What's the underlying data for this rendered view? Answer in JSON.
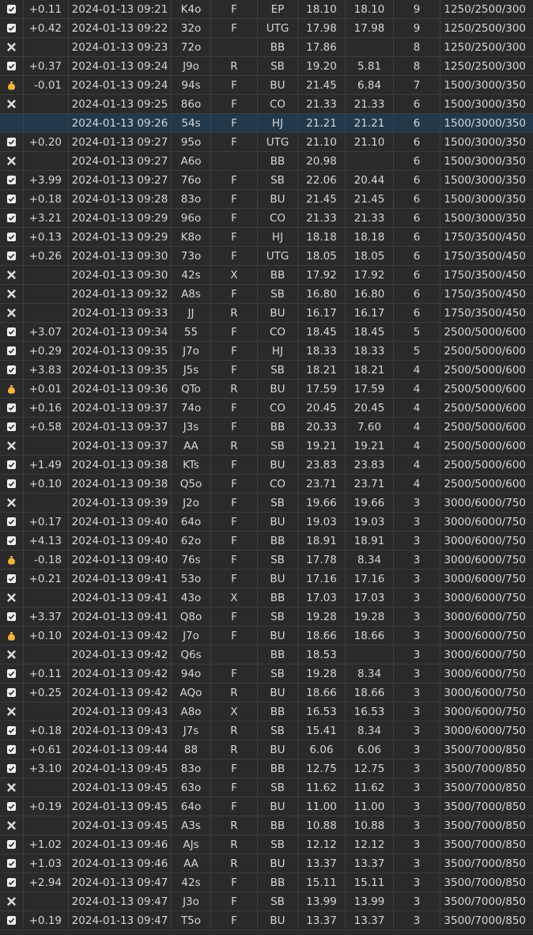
{
  "colors": {
    "background": "#2a2a2a",
    "selected_row": "#22394c",
    "check": "#f2f2f2",
    "x": "#dcdcdc",
    "bag": "#f0b53a"
  },
  "rows": [
    {
      "status": "check",
      "net": "+0.11",
      "time": "2024-01-13 09:21",
      "hand": "K4o",
      "action": "F",
      "pos": "EP",
      "stack": "18.10",
      "end": "18.10",
      "players": "9",
      "blinds": "1250/2500/300"
    },
    {
      "status": "check",
      "net": "+0.42",
      "time": "2024-01-13 09:22",
      "hand": "32o",
      "action": "F",
      "pos": "UTG",
      "stack": "17.98",
      "end": "17.98",
      "players": "9",
      "blinds": "1250/2500/300"
    },
    {
      "status": "x",
      "net": "",
      "time": "2024-01-13 09:23",
      "hand": "72o",
      "action": "",
      "pos": "BB",
      "stack": "17.86",
      "end": "",
      "players": "8",
      "blinds": "1250/2500/300"
    },
    {
      "status": "check",
      "net": "+0.37",
      "time": "2024-01-13 09:24",
      "hand": "J9o",
      "action": "R",
      "pos": "SB",
      "stack": "19.20",
      "end": "5.81",
      "players": "8",
      "blinds": "1250/2500/300"
    },
    {
      "status": "bag",
      "net": "-0.01",
      "time": "2024-01-13 09:24",
      "hand": "94s",
      "action": "F",
      "pos": "BU",
      "stack": "21.45",
      "end": "6.84",
      "players": "7",
      "blinds": "1500/3000/350"
    },
    {
      "status": "x",
      "net": "",
      "time": "2024-01-13 09:25",
      "hand": "86o",
      "action": "F",
      "pos": "CO",
      "stack": "21.33",
      "end": "21.33",
      "players": "6",
      "blinds": "1500/3000/350"
    },
    {
      "status": "",
      "net": "",
      "time": "2024-01-13 09:26",
      "hand": "54s",
      "action": "F",
      "pos": "HJ",
      "stack": "21.21",
      "end": "21.21",
      "players": "6",
      "blinds": "1500/3000/350",
      "selected": true
    },
    {
      "status": "check",
      "net": "+0.20",
      "time": "2024-01-13 09:27",
      "hand": "95o",
      "action": "F",
      "pos": "UTG",
      "stack": "21.10",
      "end": "21.10",
      "players": "6",
      "blinds": "1500/3000/350"
    },
    {
      "status": "x",
      "net": "",
      "time": "2024-01-13 09:27",
      "hand": "A6o",
      "action": "",
      "pos": "BB",
      "stack": "20.98",
      "end": "",
      "players": "6",
      "blinds": "1500/3000/350"
    },
    {
      "status": "check",
      "net": "+3.99",
      "time": "2024-01-13 09:27",
      "hand": "76o",
      "action": "F",
      "pos": "SB",
      "stack": "22.06",
      "end": "20.44",
      "players": "6",
      "blinds": "1500/3000/350"
    },
    {
      "status": "check",
      "net": "+0.18",
      "time": "2024-01-13 09:28",
      "hand": "83o",
      "action": "F",
      "pos": "BU",
      "stack": "21.45",
      "end": "21.45",
      "players": "6",
      "blinds": "1500/3000/350"
    },
    {
      "status": "check",
      "net": "+3.21",
      "time": "2024-01-13 09:29",
      "hand": "96o",
      "action": "F",
      "pos": "CO",
      "stack": "21.33",
      "end": "21.33",
      "players": "6",
      "blinds": "1500/3000/350"
    },
    {
      "status": "check",
      "net": "+0.13",
      "time": "2024-01-13 09:29",
      "hand": "K8o",
      "action": "F",
      "pos": "HJ",
      "stack": "18.18",
      "end": "18.18",
      "players": "6",
      "blinds": "1750/3500/450"
    },
    {
      "status": "check",
      "net": "+0.26",
      "time": "2024-01-13 09:30",
      "hand": "73o",
      "action": "F",
      "pos": "UTG",
      "stack": "18.05",
      "end": "18.05",
      "players": "6",
      "blinds": "1750/3500/450"
    },
    {
      "status": "x",
      "net": "",
      "time": "2024-01-13 09:30",
      "hand": "42s",
      "action": "X",
      "pos": "BB",
      "stack": "17.92",
      "end": "17.92",
      "players": "6",
      "blinds": "1750/3500/450"
    },
    {
      "status": "x",
      "net": "",
      "time": "2024-01-13 09:32",
      "hand": "A8s",
      "action": "F",
      "pos": "SB",
      "stack": "16.80",
      "end": "16.80",
      "players": "6",
      "blinds": "1750/3500/450"
    },
    {
      "status": "x",
      "net": "",
      "time": "2024-01-13 09:33",
      "hand": "JJ",
      "action": "R",
      "pos": "BU",
      "stack": "16.17",
      "end": "16.17",
      "players": "6",
      "blinds": "1750/3500/450"
    },
    {
      "status": "check",
      "net": "+3.07",
      "time": "2024-01-13 09:34",
      "hand": "55",
      "action": "F",
      "pos": "CO",
      "stack": "18.45",
      "end": "18.45",
      "players": "5",
      "blinds": "2500/5000/600"
    },
    {
      "status": "check",
      "net": "+0.29",
      "time": "2024-01-13 09:35",
      "hand": "J7o",
      "action": "F",
      "pos": "HJ",
      "stack": "18.33",
      "end": "18.33",
      "players": "5",
      "blinds": "2500/5000/600"
    },
    {
      "status": "check",
      "net": "+3.83",
      "time": "2024-01-13 09:35",
      "hand": "J5s",
      "action": "F",
      "pos": "SB",
      "stack": "18.21",
      "end": "18.21",
      "players": "4",
      "blinds": "2500/5000/600"
    },
    {
      "status": "bag",
      "net": "+0.01",
      "time": "2024-01-13 09:36",
      "hand": "QTo",
      "action": "R",
      "pos": "BU",
      "stack": "17.59",
      "end": "17.59",
      "players": "4",
      "blinds": "2500/5000/600"
    },
    {
      "status": "check",
      "net": "+0.16",
      "time": "2024-01-13 09:37",
      "hand": "74o",
      "action": "F",
      "pos": "CO",
      "stack": "20.45",
      "end": "20.45",
      "players": "4",
      "blinds": "2500/5000/600"
    },
    {
      "status": "check",
      "net": "+0.58",
      "time": "2024-01-13 09:37",
      "hand": "J3s",
      "action": "F",
      "pos": "BB",
      "stack": "20.33",
      "end": "7.60",
      "players": "4",
      "blinds": "2500/5000/600"
    },
    {
      "status": "x",
      "net": "",
      "time": "2024-01-13 09:37",
      "hand": "AA",
      "action": "R",
      "pos": "SB",
      "stack": "19.21",
      "end": "19.21",
      "players": "4",
      "blinds": "2500/5000/600"
    },
    {
      "status": "check",
      "net": "+1.49",
      "time": "2024-01-13 09:38",
      "hand": "KTs",
      "action": "F",
      "pos": "BU",
      "stack": "23.83",
      "end": "23.83",
      "players": "4",
      "blinds": "2500/5000/600"
    },
    {
      "status": "check",
      "net": "+0.10",
      "time": "2024-01-13 09:38",
      "hand": "Q5o",
      "action": "F",
      "pos": "CO",
      "stack": "23.71",
      "end": "23.71",
      "players": "4",
      "blinds": "2500/5000/600"
    },
    {
      "status": "x",
      "net": "",
      "time": "2024-01-13 09:39",
      "hand": "J2o",
      "action": "F",
      "pos": "SB",
      "stack": "19.66",
      "end": "19.66",
      "players": "3",
      "blinds": "3000/6000/750"
    },
    {
      "status": "check",
      "net": "+0.17",
      "time": "2024-01-13 09:40",
      "hand": "64o",
      "action": "F",
      "pos": "BU",
      "stack": "19.03",
      "end": "19.03",
      "players": "3",
      "blinds": "3000/6000/750"
    },
    {
      "status": "check",
      "net": "+4.13",
      "time": "2024-01-13 09:40",
      "hand": "62o",
      "action": "F",
      "pos": "BB",
      "stack": "18.91",
      "end": "18.91",
      "players": "3",
      "blinds": "3000/6000/750"
    },
    {
      "status": "bag",
      "net": "-0.18",
      "time": "2024-01-13 09:40",
      "hand": "76s",
      "action": "F",
      "pos": "SB",
      "stack": "17.78",
      "end": "8.34",
      "players": "3",
      "blinds": "3000/6000/750"
    },
    {
      "status": "check",
      "net": "+0.21",
      "time": "2024-01-13 09:41",
      "hand": "53o",
      "action": "F",
      "pos": "BU",
      "stack": "17.16",
      "end": "17.16",
      "players": "3",
      "blinds": "3000/6000/750"
    },
    {
      "status": "x",
      "net": "",
      "time": "2024-01-13 09:41",
      "hand": "43o",
      "action": "X",
      "pos": "BB",
      "stack": "17.03",
      "end": "17.03",
      "players": "3",
      "blinds": "3000/6000/750"
    },
    {
      "status": "check",
      "net": "+3.37",
      "time": "2024-01-13 09:41",
      "hand": "Q8o",
      "action": "F",
      "pos": "SB",
      "stack": "19.28",
      "end": "19.28",
      "players": "3",
      "blinds": "3000/6000/750"
    },
    {
      "status": "bag",
      "net": "+0.10",
      "time": "2024-01-13 09:42",
      "hand": "J7o",
      "action": "F",
      "pos": "BU",
      "stack": "18.66",
      "end": "18.66",
      "players": "3",
      "blinds": "3000/6000/750"
    },
    {
      "status": "x",
      "net": "",
      "time": "2024-01-13 09:42",
      "hand": "Q6s",
      "action": "",
      "pos": "BB",
      "stack": "18.53",
      "end": "",
      "players": "3",
      "blinds": "3000/6000/750"
    },
    {
      "status": "check",
      "net": "+0.11",
      "time": "2024-01-13 09:42",
      "hand": "94o",
      "action": "F",
      "pos": "SB",
      "stack": "19.28",
      "end": "8.34",
      "players": "3",
      "blinds": "3000/6000/750"
    },
    {
      "status": "check",
      "net": "+0.25",
      "time": "2024-01-13 09:42",
      "hand": "AQo",
      "action": "R",
      "pos": "BU",
      "stack": "18.66",
      "end": "18.66",
      "players": "3",
      "blinds": "3000/6000/750"
    },
    {
      "status": "x",
      "net": "",
      "time": "2024-01-13 09:43",
      "hand": "A8o",
      "action": "X",
      "pos": "BB",
      "stack": "16.53",
      "end": "16.53",
      "players": "3",
      "blinds": "3000/6000/750"
    },
    {
      "status": "check",
      "net": "+0.18",
      "time": "2024-01-13 09:43",
      "hand": "J7s",
      "action": "R",
      "pos": "SB",
      "stack": "15.41",
      "end": "8.34",
      "players": "3",
      "blinds": "3000/6000/750"
    },
    {
      "status": "check",
      "net": "+0.61",
      "time": "2024-01-13 09:44",
      "hand": "88",
      "action": "R",
      "pos": "BU",
      "stack": "6.06",
      "end": "6.06",
      "players": "3",
      "blinds": "3500/7000/850"
    },
    {
      "status": "check",
      "net": "+3.10",
      "time": "2024-01-13 09:45",
      "hand": "83o",
      "action": "F",
      "pos": "BB",
      "stack": "12.75",
      "end": "12.75",
      "players": "3",
      "blinds": "3500/7000/850"
    },
    {
      "status": "x",
      "net": "",
      "time": "2024-01-13 09:45",
      "hand": "63o",
      "action": "F",
      "pos": "SB",
      "stack": "11.62",
      "end": "11.62",
      "players": "3",
      "blinds": "3500/7000/850"
    },
    {
      "status": "check",
      "net": "+0.19",
      "time": "2024-01-13 09:45",
      "hand": "64o",
      "action": "F",
      "pos": "BU",
      "stack": "11.00",
      "end": "11.00",
      "players": "3",
      "blinds": "3500/7000/850"
    },
    {
      "status": "x",
      "net": "",
      "time": "2024-01-13 09:45",
      "hand": "A3s",
      "action": "R",
      "pos": "BB",
      "stack": "10.88",
      "end": "10.88",
      "players": "3",
      "blinds": "3500/7000/850"
    },
    {
      "status": "check",
      "net": "+1.02",
      "time": "2024-01-13 09:46",
      "hand": "AJs",
      "action": "R",
      "pos": "SB",
      "stack": "12.12",
      "end": "12.12",
      "players": "3",
      "blinds": "3500/7000/850"
    },
    {
      "status": "check",
      "net": "+1.03",
      "time": "2024-01-13 09:46",
      "hand": "AA",
      "action": "R",
      "pos": "BU",
      "stack": "13.37",
      "end": "13.37",
      "players": "3",
      "blinds": "3500/7000/850"
    },
    {
      "status": "check",
      "net": "+2.94",
      "time": "2024-01-13 09:47",
      "hand": "42s",
      "action": "F",
      "pos": "BB",
      "stack": "15.11",
      "end": "15.11",
      "players": "3",
      "blinds": "3500/7000/850"
    },
    {
      "status": "x",
      "net": "",
      "time": "2024-01-13 09:47",
      "hand": "J3o",
      "action": "F",
      "pos": "SB",
      "stack": "13.99",
      "end": "13.99",
      "players": "3",
      "blinds": "3500/7000/850"
    },
    {
      "status": "check",
      "net": "+0.19",
      "time": "2024-01-13 09:47",
      "hand": "T5o",
      "action": "F",
      "pos": "BU",
      "stack": "13.37",
      "end": "13.37",
      "players": "3",
      "blinds": "3500/7000/850"
    }
  ]
}
